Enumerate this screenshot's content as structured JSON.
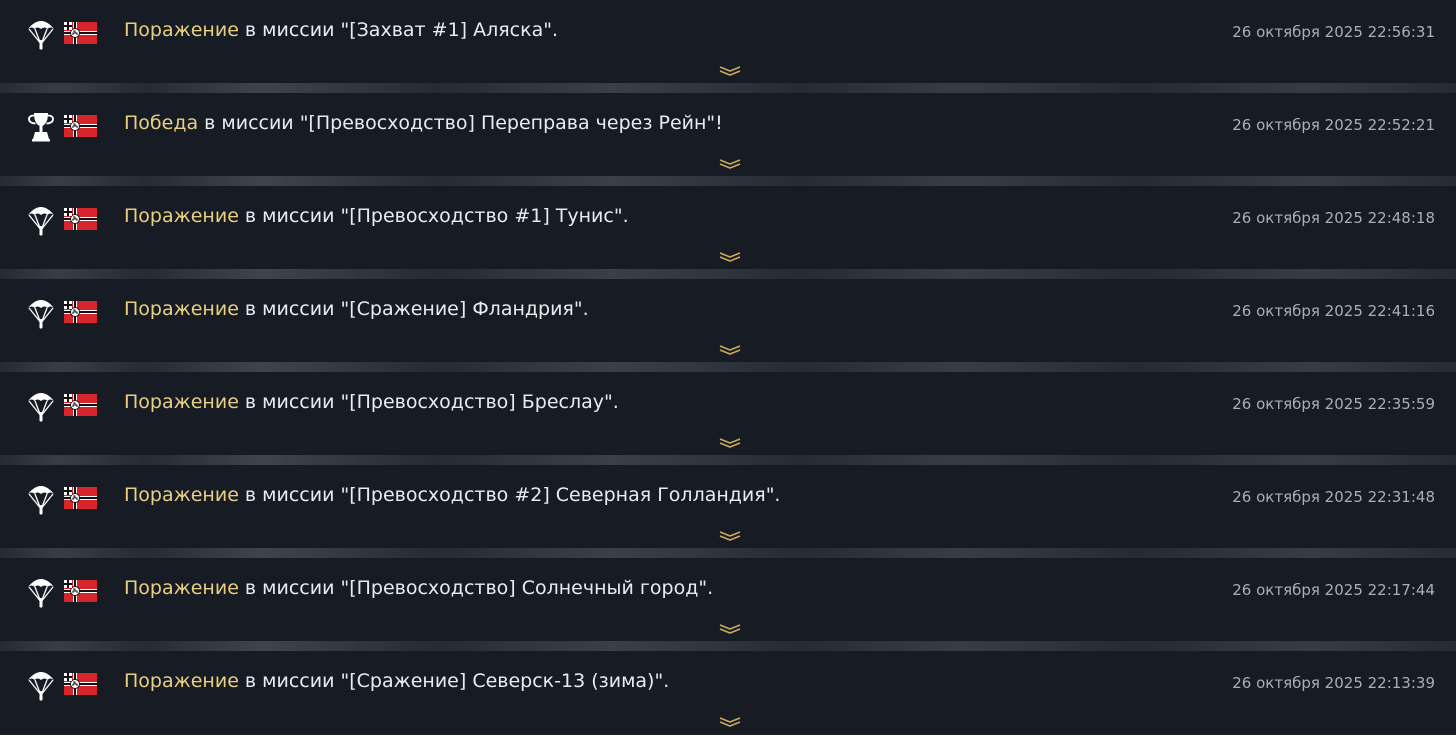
{
  "entries": [
    {
      "result": "Поражение",
      "text": " в миссии \"[Захват #1] Аляска\".",
      "timestamp": "26 октября 2025 22:56:31",
      "status_icon": "parachute-icon"
    },
    {
      "result": "Победа",
      "text": " в миссии \"[Превосходство] Переправа через Рейн\"!",
      "timestamp": "26 октября 2025 22:52:21",
      "status_icon": "trophy-icon"
    },
    {
      "result": "Поражение",
      "text": " в миссии \"[Превосходство #1] Тунис\".",
      "timestamp": "26 октября 2025 22:48:18",
      "status_icon": "parachute-icon"
    },
    {
      "result": "Поражение",
      "text": " в миссии \"[Сражение] Фландрия\".",
      "timestamp": "26 октября 2025 22:41:16",
      "status_icon": "parachute-icon"
    },
    {
      "result": "Поражение",
      "text": " в миссии \"[Превосходство] Бреслау\".",
      "timestamp": "26 октября 2025 22:35:59",
      "status_icon": "parachute-icon"
    },
    {
      "result": "Поражение",
      "text": " в миссии \"[Превосходство #2] Северная Голландия\".",
      "timestamp": "26 октября 2025 22:31:48",
      "status_icon": "parachute-icon"
    },
    {
      "result": "Поражение",
      "text": " в миссии \"[Превосходство] Солнечный город\".",
      "timestamp": "26 октября 2025 22:17:44",
      "status_icon": "parachute-icon"
    },
    {
      "result": "Поражение",
      "text": " в миссии \"[Сражение] Северск-13 (зима)\".",
      "timestamp": "26 октября 2025 22:13:39",
      "status_icon": "parachute-icon"
    }
  ],
  "colors": {
    "row_bg": "#171c24",
    "separator": "#262b33",
    "result_text": "#e9cf83",
    "message_text": "#e9ecef",
    "timestamp_text": "#a9afb7",
    "flag_red": "#d7262b",
    "chevron": "#c9a95c"
  },
  "icons": {
    "flag": "war-ensign-flag-icon",
    "expand": "double-chevron-down-icon"
  }
}
